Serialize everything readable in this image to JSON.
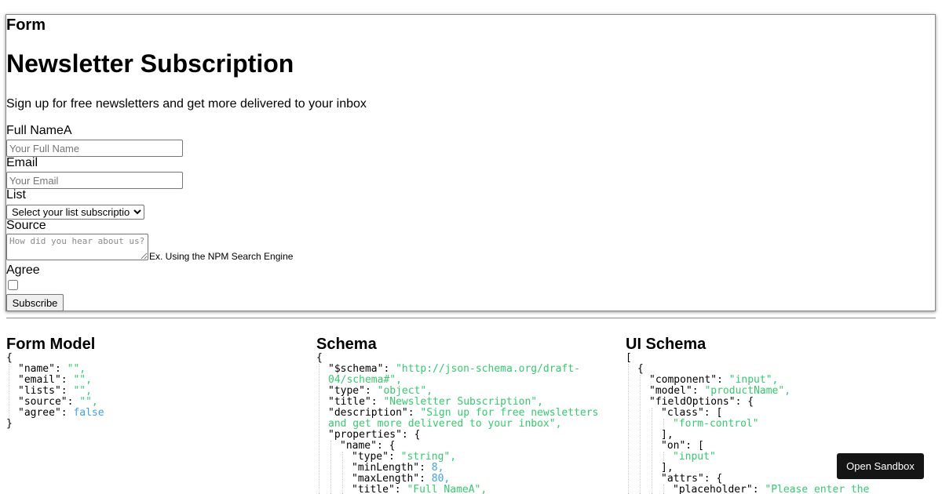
{
  "form_panel": {
    "heading": "Form",
    "title": "Newsletter Subscription",
    "description": "Sign up for free newsletters and get more delivered to your inbox",
    "fields": {
      "name_label": "Full NameA",
      "name_placeholder": "Your Full Name",
      "email_label": "Email",
      "email_placeholder": "Your Email",
      "list_label": "List",
      "list_selected": "Select your list subscription",
      "source_label": "Source",
      "source_placeholder": "How did you hear about us?",
      "source_hint": "Ex. Using the NPM Search Engine",
      "agree_label": "Agree",
      "agree_checked": false
    },
    "submit_label": "Subscribe"
  },
  "panels": {
    "model_title": "Form Model",
    "schema_title": "Schema",
    "ui_schema_title": "UI Schema"
  },
  "code": {
    "model": [
      [
        {
          "t": "{"
        }
      ],
      [
        {
          "t": "\"name\": "
        },
        {
          "t": "\"\",",
          "c": "str"
        }
      ],
      [
        {
          "t": "\"email\": "
        },
        {
          "t": "\"\",",
          "c": "str"
        }
      ],
      [
        {
          "t": "\"lists\": "
        },
        {
          "t": "\"\",",
          "c": "str"
        }
      ],
      [
        {
          "t": "\"source\": "
        },
        {
          "t": "\"\",",
          "c": "str"
        }
      ],
      [
        {
          "t": "\"agree\": "
        },
        {
          "t": "false",
          "c": "bool"
        }
      ],
      [
        {
          "t": "}"
        }
      ]
    ],
    "schema": [
      [
        {
          "t": "{"
        }
      ],
      [
        {
          "t": "\"$schema\": "
        },
        {
          "t": "\"http://json-schema.org/draft-",
          "c": "str"
        }
      ],
      [
        {
          "t": "04/schema#\",",
          "c": "str"
        }
      ],
      [
        {
          "t": "\"type\": "
        },
        {
          "t": "\"object\",",
          "c": "str"
        }
      ],
      [
        {
          "t": "\"title\": "
        },
        {
          "t": "\"Newsletter Subscription\",",
          "c": "str"
        }
      ],
      [
        {
          "t": "\"description\": "
        },
        {
          "t": "\"Sign up for free newsletters",
          "c": "str"
        }
      ],
      [
        {
          "t": "and get more delivered to your inbox\",",
          "c": "str"
        }
      ],
      [
        {
          "t": "\"properties\": {"
        }
      ],
      [
        {
          "t": "\"name\": {"
        }
      ],
      [
        {
          "t": "\"type\": "
        },
        {
          "t": "\"string\",",
          "c": "str"
        }
      ],
      [
        {
          "t": "\"minLength\": "
        },
        {
          "t": "8,",
          "c": "num"
        }
      ],
      [
        {
          "t": "\"maxLength\": "
        },
        {
          "t": "80,",
          "c": "num"
        }
      ],
      [
        {
          "t": "\"title\": "
        },
        {
          "t": "\"Full NameA\",",
          "c": "str"
        }
      ]
    ],
    "ui_schema": [
      [
        {
          "t": "["
        }
      ],
      [
        {
          "t": "{"
        }
      ],
      [
        {
          "t": "\"component\": "
        },
        {
          "t": "\"input\",",
          "c": "str"
        }
      ],
      [
        {
          "t": "\"model\": "
        },
        {
          "t": "\"productName\",",
          "c": "str"
        }
      ],
      [
        {
          "t": "\"fieldOptions\": {"
        }
      ],
      [
        {
          "t": "\"class\": ["
        }
      ],
      [
        {
          "t": "\"form-control\"",
          "c": "str"
        }
      ],
      [
        {
          "t": "],"
        }
      ],
      [
        {
          "t": "\"on\": ["
        }
      ],
      [
        {
          "t": "\"input\"",
          "c": "str"
        }
      ],
      [
        {
          "t": "],"
        }
      ],
      [
        {
          "t": "\"attrs\": {"
        }
      ],
      [
        {
          "t": "\"placeholder\": "
        },
        {
          "t": "\"Please enter the",
          "c": "str"
        }
      ]
    ]
  },
  "sandbox_label": "Open Sandbox"
}
